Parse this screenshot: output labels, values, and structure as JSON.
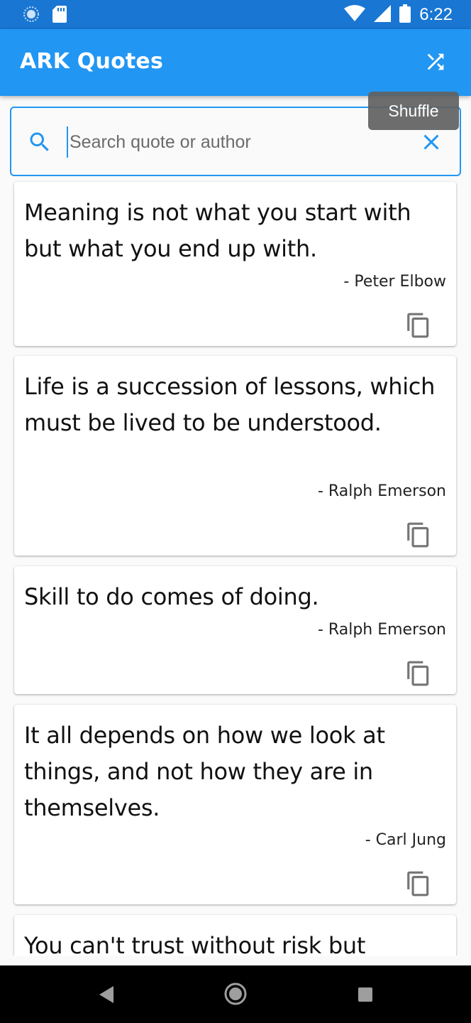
{
  "status_bar": {
    "time": "6:22",
    "icons": [
      "app-notification-icon",
      "sd-card-icon",
      "wifi-icon",
      "cell-signal-icon",
      "battery-icon"
    ]
  },
  "app_bar": {
    "title": "ARK Quotes",
    "shuffle_icon": "shuffle-icon",
    "background": "#2196f3"
  },
  "tooltip": {
    "text": "Shuffle"
  },
  "search": {
    "placeholder": "Search quote or author",
    "value": "",
    "icon": "search-icon",
    "clear_icon": "close-icon",
    "accent": "#2196f3"
  },
  "quotes": [
    {
      "text": "Meaning is not what you start with but what you end up with.",
      "author": "- Peter Elbow"
    },
    {
      "text": "Life is a succession of lessons, which must be lived to be understood.",
      "author": "- Ralph Emerson"
    },
    {
      "text": "Skill to do comes of doing.",
      "author": "- Ralph Emerson"
    },
    {
      "text": "It all depends on how we look at things, and not how they are in themselves.",
      "author": "- Carl Jung"
    },
    {
      "text": "You can't trust without risk but",
      "author": ""
    }
  ],
  "nav_bar": {
    "buttons": [
      "back-icon",
      "home-icon",
      "recents-icon"
    ]
  }
}
